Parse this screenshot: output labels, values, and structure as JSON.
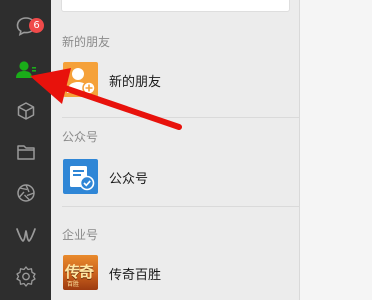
{
  "rail": {
    "chat_badge": "6",
    "items": [
      {
        "icon": "chat-icon"
      },
      {
        "icon": "contacts-icon",
        "active": true
      },
      {
        "icon": "favorites-cube-icon"
      },
      {
        "icon": "files-folder-icon"
      },
      {
        "icon": "moments-aperture-icon"
      },
      {
        "icon": "mini-programs-icon"
      },
      {
        "icon": "settings-gear-icon"
      }
    ]
  },
  "contacts": {
    "sections": [
      {
        "header": "新的朋友",
        "items": [
          {
            "label": "新的朋友",
            "avatar": "new-friend-avatar"
          }
        ]
      },
      {
        "header": "公众号",
        "items": [
          {
            "label": "公众号",
            "avatar": "official-accounts-avatar"
          }
        ]
      },
      {
        "header": "企业号",
        "items": [
          {
            "label": "传奇百胜",
            "avatar": "game-avatar",
            "avatar_text": "传奇",
            "avatar_subtext": "百胜"
          }
        ]
      }
    ]
  },
  "colors": {
    "rail_bg": "#2e2e2e",
    "active_icon": "#1aad19",
    "badge": "#f04a4a",
    "annotation_arrow": "#e8120c"
  }
}
